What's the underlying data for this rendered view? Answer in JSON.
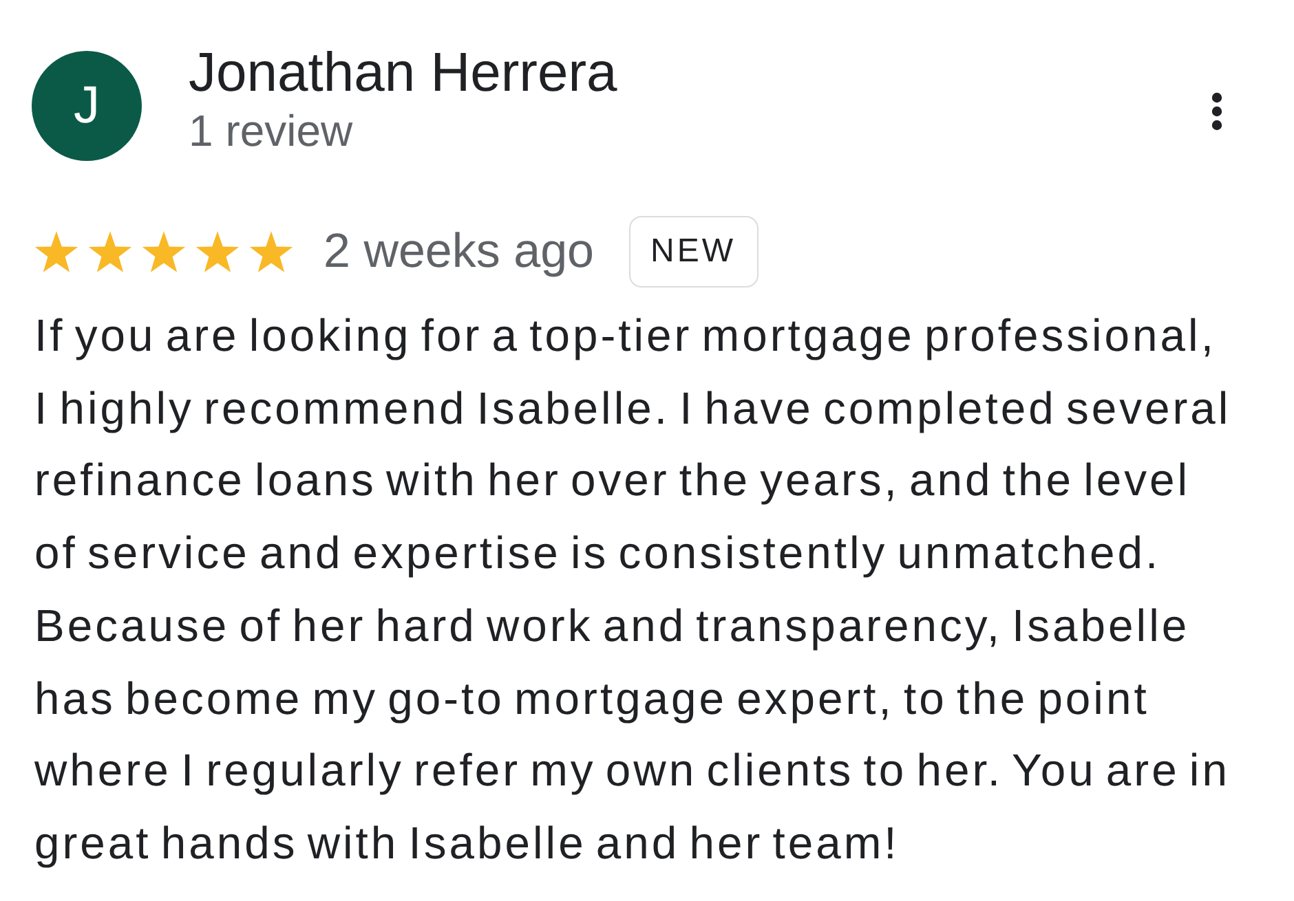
{
  "reviewer": {
    "initial": "J",
    "name": "Jonathan Herrera",
    "review_count": "1 review"
  },
  "review": {
    "stars": 5,
    "time": "2 weeks ago",
    "badge": "NEW",
    "text": "If you are looking for a top-tier mortgage professional, I highly recommend Isabelle. I have completed several refinance loans with her over the years, and the level of service and expertise is consistently unmatched. Because of her hard work and transparency, Isabelle has become my go-to mortgage expert, to the point where I regularly refer my own clients to her. You are in great hands with Isabelle and her team!"
  }
}
